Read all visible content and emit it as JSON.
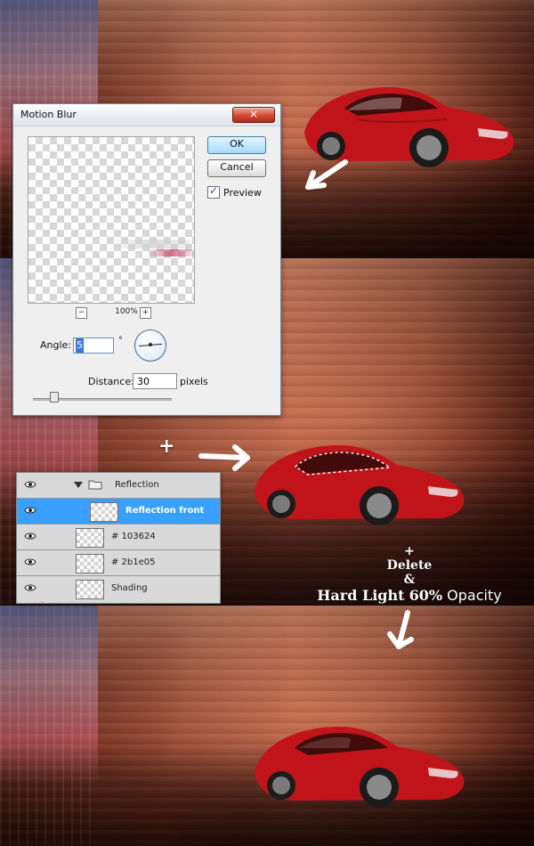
{
  "dialog": {
    "title": "Motion Blur",
    "close_glyph": "×",
    "ok_label": "OK",
    "cancel_label": "Cancel",
    "preview_label": "Preview",
    "zoom_minus": "−",
    "zoom_plus": "+",
    "zoom_value": "100%",
    "angle_label": "Angle:",
    "angle_value": "5",
    "degree_symbol": "°",
    "distance_label": "Distance:",
    "distance_value": "30",
    "distance_unit": "pixels",
    "slider_fraction": 0.15
  },
  "layers_panel": {
    "rows": [
      {
        "name": "Reflection",
        "type": "group"
      },
      {
        "name": "Reflection front",
        "type": "layer",
        "selected": true
      },
      {
        "name": "# 103624",
        "type": "layer"
      },
      {
        "name": "# 2b1e05",
        "type": "layer"
      },
      {
        "name": "Shading",
        "type": "layer"
      }
    ]
  },
  "annotations": {
    "plus_top": "+",
    "plus_note": "+",
    "delete": "Delete",
    "ampersand": "&",
    "blend_mode": "Hard Light",
    "opacity_value": "60%",
    "opacity_word": "Opacity"
  },
  "colors": {
    "selected_layer": "#39a0ff",
    "car_red": "#c0141a",
    "dialog_bg": "#efefef"
  },
  "icons": [
    "close-icon",
    "checkbox-check-icon",
    "zoom-out-icon",
    "zoom-in-icon",
    "angle-dial-icon",
    "eye-icon",
    "folder-icon",
    "arrow-icon"
  ]
}
